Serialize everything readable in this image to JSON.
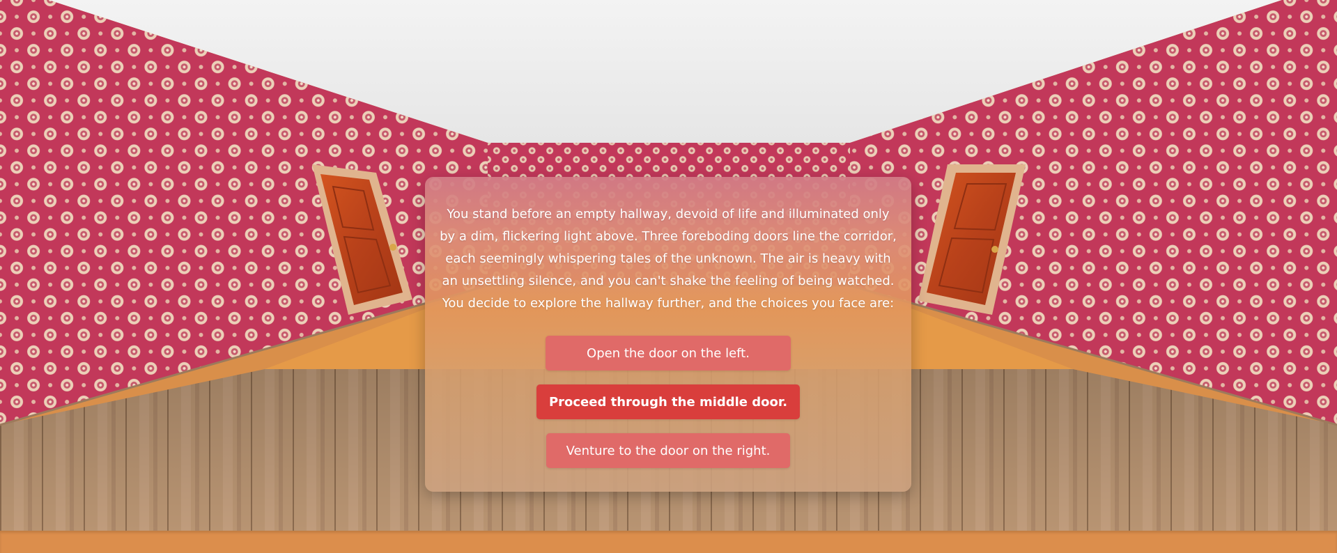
{
  "scene": {
    "type": "hallway",
    "doors": [
      "left",
      "middle",
      "right"
    ],
    "wallpaper_color": "#c2385a",
    "ceiling_color": "#efefef",
    "floor_color": "#b08a66",
    "bottom_bar_color": "#dc8e4c"
  },
  "dialog": {
    "narrative": "You stand before an empty hallway, devoid of life and illuminated only by a dim, flickering light above. Three foreboding doors line the corridor, each seemingly whispering tales of the unknown. The air is heavy with an unsettling silence, and you can't shake the feeling of being watched. You decide to explore the hallway further, and the choices you face are:",
    "choices": [
      {
        "label": "Open the door on the left.",
        "state": "normal",
        "color": "#e06a68"
      },
      {
        "label": "Proceed through the middle door.",
        "state": "hover",
        "color": "#d93e3c"
      },
      {
        "label": "Venture to the door on the right.",
        "state": "normal",
        "color": "#e06a68"
      }
    ]
  }
}
